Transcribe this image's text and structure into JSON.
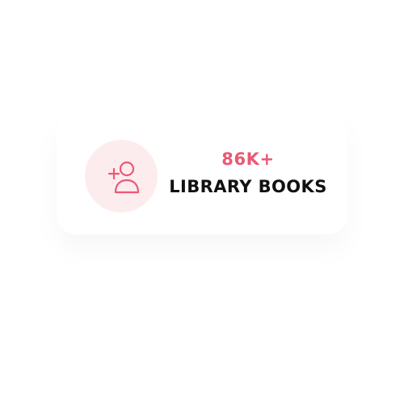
{
  "stat": {
    "value": "86K+",
    "label": "LIBRARY BOOKS",
    "icon": "user-plus-icon",
    "accent": "#e95a73",
    "icon_background": "#fdecee",
    "text_color": "#111111"
  }
}
